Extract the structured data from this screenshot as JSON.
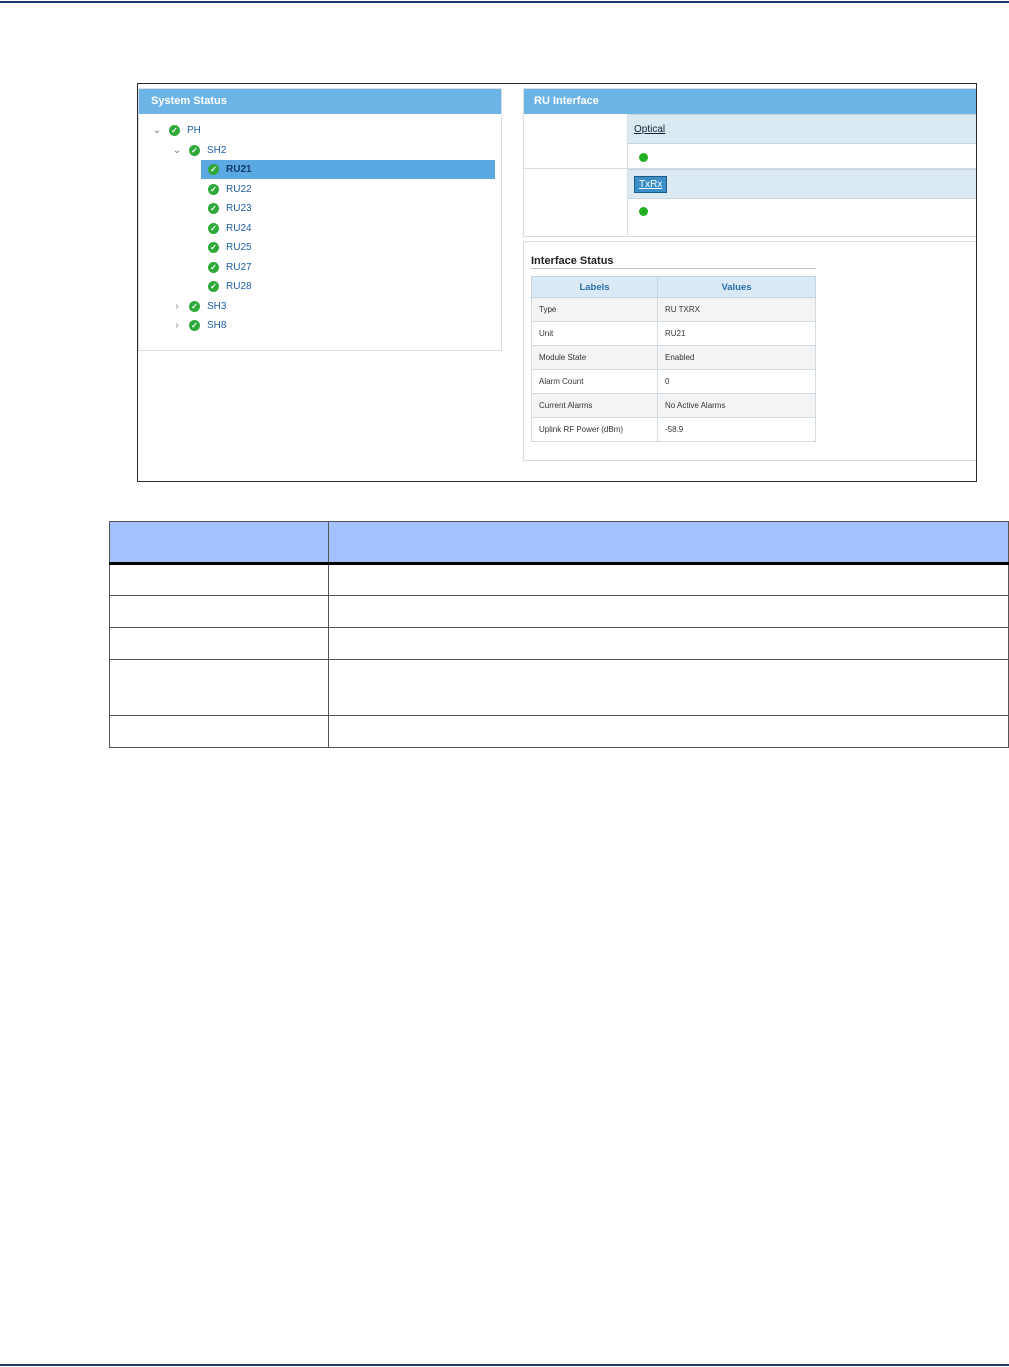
{
  "system_status": {
    "title": "System Status",
    "tree": [
      {
        "label": "PH",
        "level": 0,
        "chevron": "chevron-down",
        "selected": false
      },
      {
        "label": "SH2",
        "level": 1,
        "chevron": "chevron-down",
        "selected": false
      },
      {
        "label": "RU21",
        "level": 2,
        "chevron": "",
        "selected": true
      },
      {
        "label": "RU22",
        "level": 2,
        "chevron": "",
        "selected": false
      },
      {
        "label": "RU23",
        "level": 2,
        "chevron": "",
        "selected": false
      },
      {
        "label": "RU24",
        "level": 2,
        "chevron": "",
        "selected": false
      },
      {
        "label": "RU25",
        "level": 2,
        "chevron": "",
        "selected": false
      },
      {
        "label": "RU27",
        "level": 2,
        "chevron": "",
        "selected": false
      },
      {
        "label": "RU28",
        "level": 2,
        "chevron": "",
        "selected": false
      },
      {
        "label": "SH3",
        "level": 1,
        "chevron": "chevron-right",
        "selected": false
      },
      {
        "label": "SH8",
        "level": 1,
        "chevron": "chevron-right",
        "selected": false
      }
    ]
  },
  "ru_interface": {
    "title": "RU Interface",
    "optical_label": "Optical",
    "txrx_label": "TxRx",
    "status_color": "#21b022"
  },
  "interface_status": {
    "title": "Interface Status",
    "col_labels": "Labels",
    "col_values": "Values",
    "rows": [
      {
        "label": "Type",
        "value": "RU TXRX"
      },
      {
        "label": "Unit",
        "value": "RU21"
      },
      {
        "label": "Module State",
        "value": "Enabled"
      },
      {
        "label": "Alarm Count",
        "value": "0"
      },
      {
        "label": "Current Alarms",
        "value": "No Active Alarms"
      },
      {
        "label": "Uplink RF Power (dBm)",
        "value": "-58.9"
      }
    ]
  },
  "colors": {
    "header_blue": "#6cb4e6",
    "selected_row": "#5aa9e2",
    "check_green": "#2faa3a",
    "doc_table_header": "#a4c1ff",
    "rule_navy": "#1f3a6e"
  }
}
